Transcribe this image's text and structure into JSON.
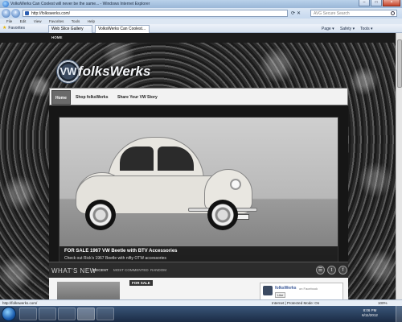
{
  "browser": {
    "window_title": "VolksWerks Can Coolest will never be the same... - Windows Internet Explorer",
    "url": "http://folkswerks.com/",
    "search_placeholder": "AVG Secure Search",
    "menu": [
      "File",
      "Edit",
      "View",
      "Favorites",
      "Tools",
      "Help"
    ],
    "favorites_label": "Favorites",
    "tabs": [
      "Web Slice Gallery",
      "VolksWerks Can Coolest..."
    ],
    "commands": [
      "Page ▾",
      "Safety ▾",
      "Tools ▾"
    ],
    "status_url": "http://folkswerks.com/",
    "status_zone": "Internet | Protected Mode: On",
    "zoom": "100%"
  },
  "site": {
    "top_link": "HOME",
    "logo_badge": "VW",
    "logo_text": "folksWerks",
    "nav": [
      "Home",
      "Shop folksWerks",
      "Share Your VW Story"
    ],
    "slide": {
      "title": "FOR SALE 1967 VW Beetle with BTV Accessories",
      "text": "Check out Rick's 1967 Beetle with nifty OTW accessories"
    },
    "slide_dots_count": 7,
    "section_title": "WHAT'S NEW",
    "categories": [
      "RECENT",
      "MOST COMMENTED",
      "RANDOM"
    ],
    "social_icons": [
      "rss-icon",
      "twitter-icon",
      "facebook-icon"
    ],
    "social_glyphs": [
      "☰",
      "t",
      "f"
    ],
    "for_sale_badge": "FOR SALE",
    "facebook_box": {
      "name": "folksWerks",
      "sub": "on Facebook",
      "like": "Like"
    }
  },
  "taskbar": {
    "time": "8:06 PM",
    "date": "6/11/2012"
  }
}
